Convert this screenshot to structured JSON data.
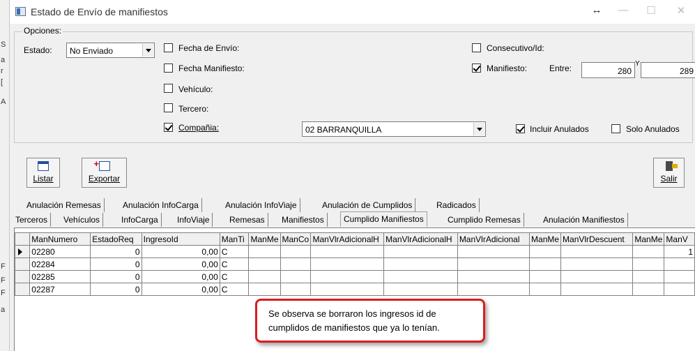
{
  "left_strip": {
    "chars": [
      "S",
      "a",
      "r",
      "[",
      "A",
      "",
      "F",
      "F",
      "F",
      "a"
    ]
  },
  "window": {
    "title": "Estado de Envío de manifiestos",
    "controls": {
      "resize": "↔",
      "minimize": "—",
      "maximize": "☐",
      "close": "✕"
    }
  },
  "options": {
    "legend": "Opciones:",
    "estado_label": "Estado:",
    "estado_value": "No Enviado",
    "fecha_envio": {
      "label": "Fecha de Envío:",
      "checked": false
    },
    "fecha_manifiesto": {
      "label": "Fecha Manifiesto:",
      "checked": false
    },
    "vehiculo": {
      "label": "Vehículo:",
      "checked": false
    },
    "tercero": {
      "label": "Tercero:",
      "checked": false
    },
    "compania": {
      "label": "Compañia:",
      "checked": true,
      "value": "02 BARRANQUILLA"
    },
    "consecutivo": {
      "label": "Consecutivo/Id:",
      "checked": false
    },
    "manifiesto": {
      "label": "Manifiesto:",
      "checked": true,
      "entre_label": "Entre:",
      "from": "280",
      "y_label": "Y",
      "to": "289"
    },
    "incluir_anulados": {
      "label": "Incluir Anulados",
      "checked": true
    },
    "solo_anulados": {
      "label": "Solo Anulados",
      "checked": false
    }
  },
  "toolbar": {
    "listar": "Listar",
    "exportar": "Exportar",
    "salir": "Salir"
  },
  "tabs_row1": [
    "Anulación Remesas",
    "Anulación InfoCarga",
    "Anulación InfoViaje",
    "Anulación de Cumplidos",
    "Radicados"
  ],
  "tabs_row2": [
    "Terceros",
    "Vehículos",
    "InfoCarga",
    "InfoViaje",
    "Remesas",
    "Manifiestos",
    "Cumplido Manifiestos",
    "Cumplido Remesas",
    "Anulación Manifiestos"
  ],
  "active_tab": "Cumplido Manifiestos",
  "grid": {
    "columns": [
      "",
      "ManNumero",
      "EstadoReq",
      "IngresoId",
      "ManTi",
      "ManMe",
      "ManCo",
      "ManVlrAdicionalH",
      "ManVlrAdicionalH",
      "ManVlrAdicional",
      "ManMe",
      "ManVlrDescuent",
      "ManMe",
      "ManV"
    ],
    "rows": [
      [
        "",
        "02280",
        "0",
        "0,00",
        "C",
        "",
        "",
        "",
        "",
        "",
        "",
        "",
        "",
        "1"
      ],
      [
        "",
        "02284",
        "0",
        "0,00",
        "C",
        "",
        "",
        "",
        "",
        "",
        "",
        "",
        "",
        ""
      ],
      [
        "",
        "02285",
        "0",
        "0,00",
        "C",
        "",
        "",
        "",
        "",
        "",
        "",
        "",
        "",
        ""
      ],
      [
        "",
        "02287",
        "0",
        "0,00",
        "C",
        "",
        "",
        "",
        "",
        "",
        "",
        "",
        "",
        ""
      ]
    ]
  },
  "callout": {
    "line1": "Se observa se borraron los ingresos id de",
    "line2": "cumplidos de manifiestos que ya lo tenían."
  },
  "colors": {
    "callout_border": "#d91d1d",
    "window_bg": "#f0f0f0",
    "icon_blue": "#1e4f9c"
  }
}
